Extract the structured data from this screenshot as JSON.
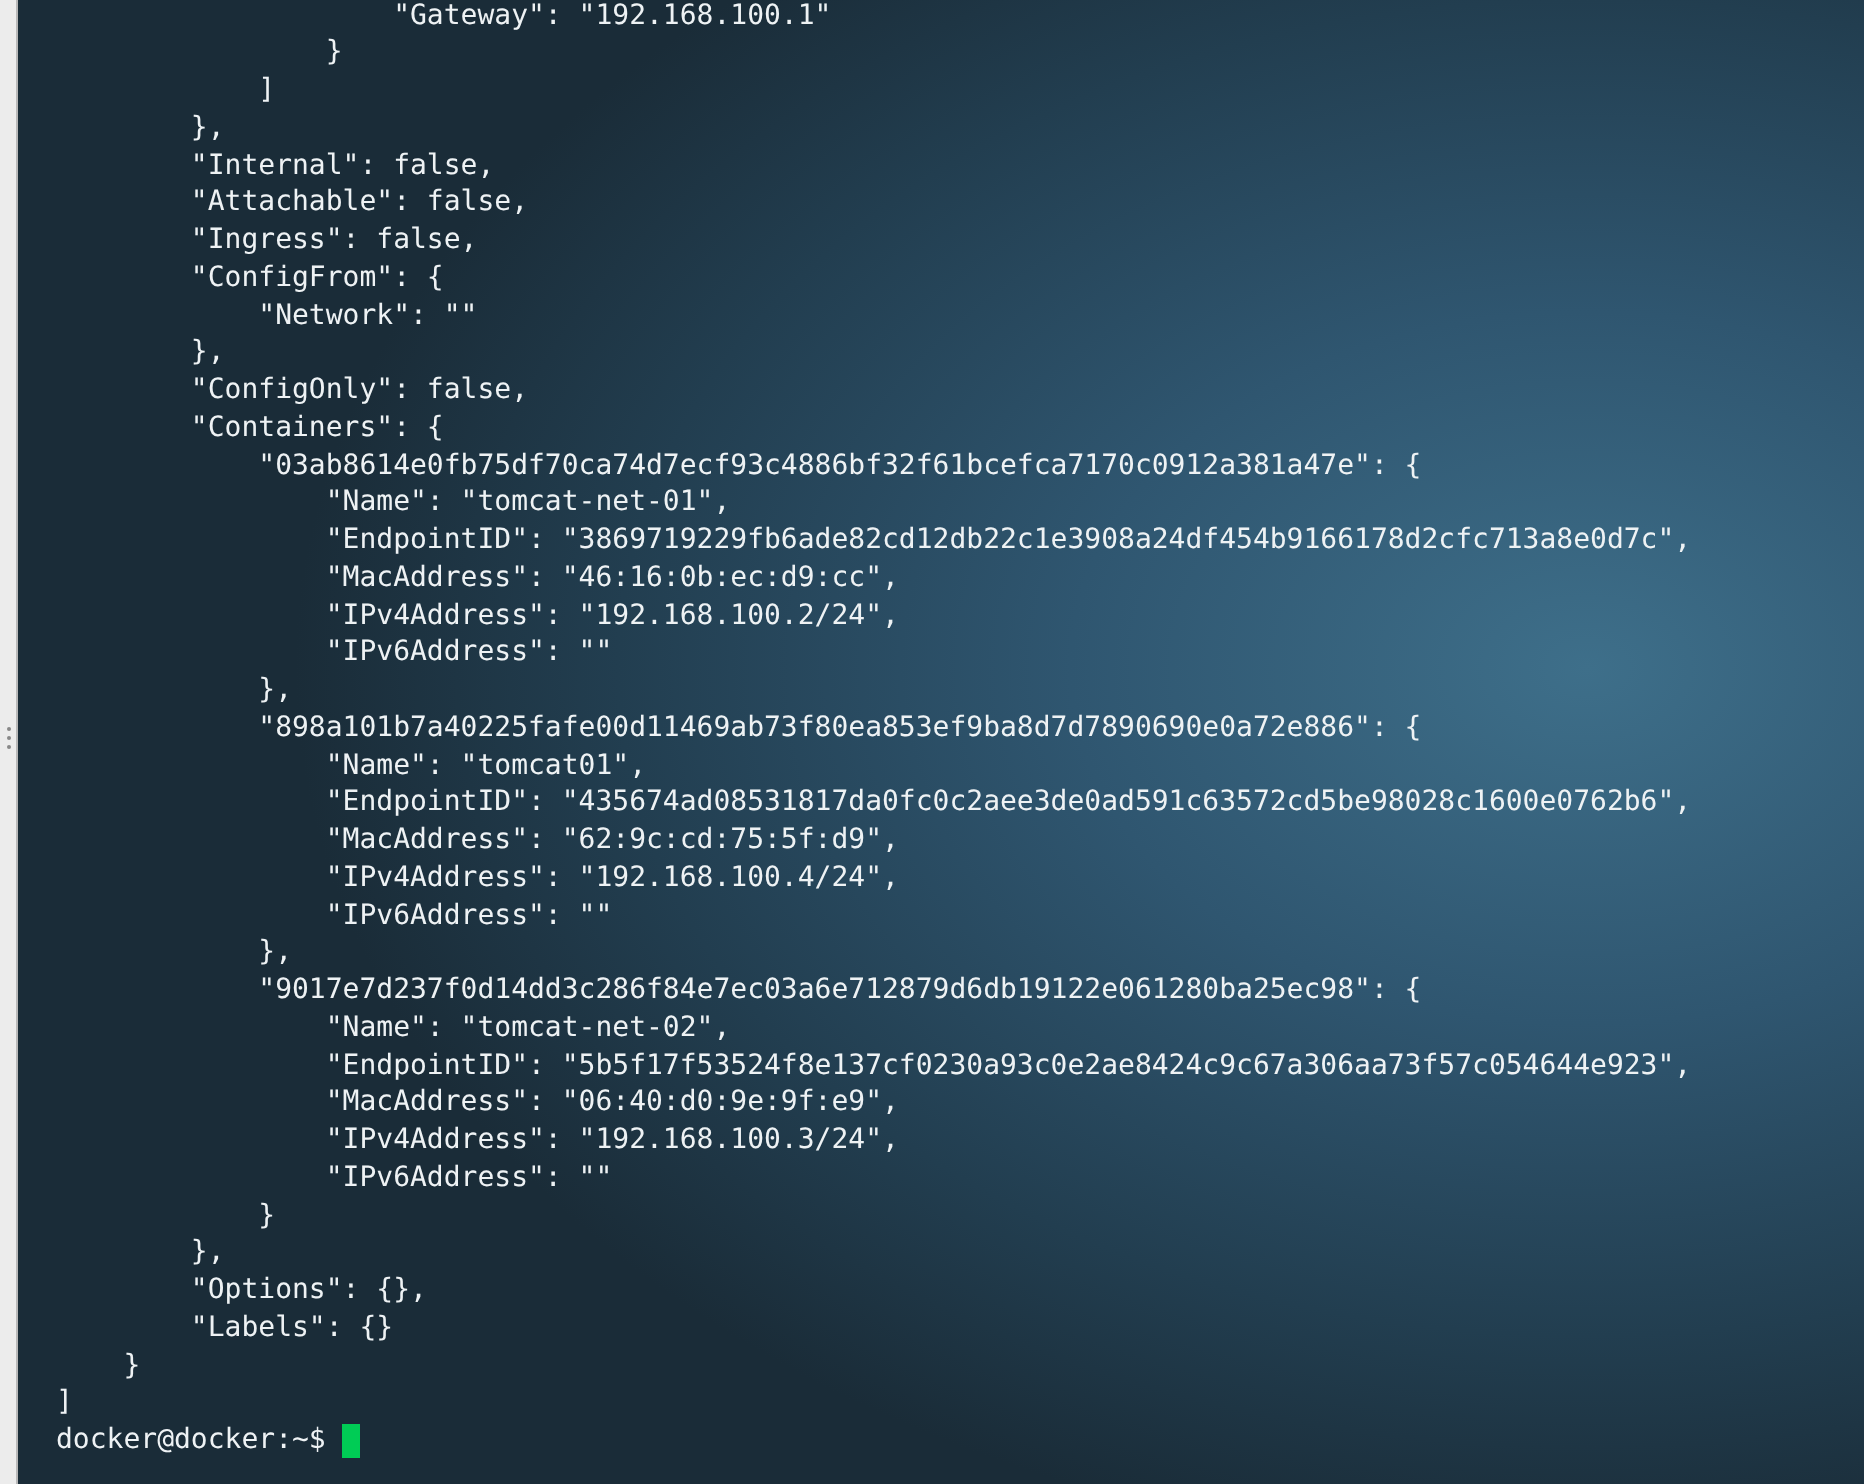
{
  "terminal": {
    "lines": [
      "                    \"Gateway\": \"192.168.100.1\"",
      "                }",
      "            ]",
      "        },",
      "        \"Internal\": false,",
      "        \"Attachable\": false,",
      "        \"Ingress\": false,",
      "        \"ConfigFrom\": {",
      "            \"Network\": \"\"",
      "        },",
      "        \"ConfigOnly\": false,",
      "        \"Containers\": {",
      "            \"03ab8614e0fb75df70ca74d7ecf93c4886bf32f61bcefca7170c0912a381a47e\": {",
      "                \"Name\": \"tomcat-net-01\",",
      "                \"EndpointID\": \"3869719229fb6ade82cd12db22c1e3908a24df454b9166178d2cfc713a8e0d7c\",",
      "                \"MacAddress\": \"46:16:0b:ec:d9:cc\",",
      "                \"IPv4Address\": \"192.168.100.2/24\",",
      "                \"IPv6Address\": \"\"",
      "            },",
      "            \"898a101b7a40225fafe00d11469ab73f80ea853ef9ba8d7d7890690e0a72e886\": {",
      "                \"Name\": \"tomcat01\",",
      "                \"EndpointID\": \"435674ad08531817da0fc0c2aee3de0ad591c63572cd5be98028c1600e0762b6\",",
      "                \"MacAddress\": \"62:9c:cd:75:5f:d9\",",
      "                \"IPv4Address\": \"192.168.100.4/24\",",
      "                \"IPv6Address\": \"\"",
      "            },",
      "            \"9017e7d237f0d14dd3c286f84e7ec03a6e712879d6db19122e061280ba25ec98\": {",
      "                \"Name\": \"tomcat-net-02\",",
      "                \"EndpointID\": \"5b5f17f53524f8e137cf0230a93c0e2ae8424c9c67a306aa73f57c054644e923\",",
      "                \"MacAddress\": \"06:40:d0:9e:9f:e9\",",
      "                \"IPv4Address\": \"192.168.100.3/24\",",
      "                \"IPv6Address\": \"\"",
      "            }",
      "        },",
      "        \"Options\": {},",
      "        \"Labels\": {}",
      "    }",
      "]"
    ],
    "prompt": "docker@docker:~$",
    "cursor": true
  }
}
